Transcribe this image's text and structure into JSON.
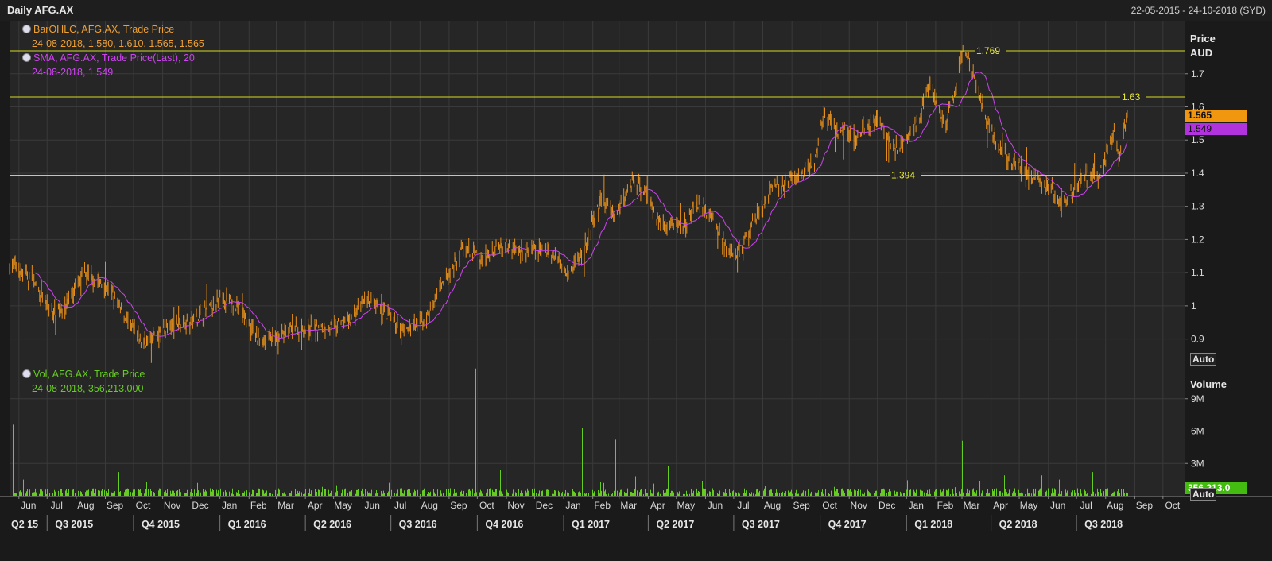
{
  "header": {
    "title": "Daily AFG.AX",
    "date_range": "22-05-2015 - 24-10-2018 (SYD)"
  },
  "legend": {
    "ohlc_label": "BarOHLC, AFG.AX, Trade Price",
    "ohlc_values": "24-08-2018, 1.580, 1.610, 1.565, 1.565",
    "sma_label": "SMA, AFG.AX, Trade Price(Last),  20",
    "sma_values": "24-08-2018, 1.549",
    "vol_label": "Vol, AFG.AX, Trade Price",
    "vol_values": "24-08-2018, 356,213.000"
  },
  "price_axis": {
    "title": "Price",
    "unit": "AUD",
    "auto_label": "Auto"
  },
  "volume_axis": {
    "title": "Volume",
    "auto_label": "Auto"
  },
  "tags": {
    "last_price": "1.565",
    "last_sma": "1.549",
    "last_volume": "356,213.0"
  },
  "colors": {
    "bars": "#e8901a",
    "sma": "#cc44ee",
    "volume": "#66cc22",
    "hlines": "#d8d820",
    "grid": "#3a3a3a",
    "price_tag": "#f0960f",
    "sma_tag": "#b033dd"
  },
  "chart_data": {
    "type": "ohlc",
    "x_range": [
      "2015-05-22",
      "2018-10-24"
    ],
    "price_ylim": [
      0.82,
      1.86
    ],
    "price_ticks": [
      "0.9",
      "1",
      "1.1",
      "1.2",
      "1.3",
      "1.4",
      "1.5",
      "1.6",
      "1.7"
    ],
    "volume_ylim": [
      0,
      12000000
    ],
    "volume_ticks": [
      "3M",
      "6M",
      "9M"
    ],
    "hlines": [
      {
        "value": 1.769,
        "label": "1.769"
      },
      {
        "value": 1.63,
        "label": "1.63"
      },
      {
        "value": 1.394,
        "label": "1.394"
      }
    ],
    "month_labels": [
      "Jun",
      "Jul",
      "Aug",
      "Sep",
      "Oct",
      "Nov",
      "Dec",
      "Jan",
      "Feb",
      "Mar",
      "Apr",
      "May",
      "Jun",
      "Jul",
      "Aug",
      "Sep",
      "Oct",
      "Nov",
      "Dec",
      "Jan",
      "Feb",
      "Mar",
      "Apr",
      "May",
      "Jun",
      "Jul",
      "Aug",
      "Sep",
      "Oct",
      "Nov",
      "Dec",
      "Jan",
      "Feb",
      "Mar",
      "Apr",
      "May",
      "Jun",
      "Jul",
      "Aug",
      "Sep",
      "Oct"
    ],
    "quarter_labels": [
      "Q2 15",
      "Q3 2015",
      "Q4 2015",
      "Q1 2016",
      "Q2 2016",
      "Q3 2016",
      "Q4 2016",
      "Q1 2017",
      "Q2 2017",
      "Q3 2017",
      "Q4 2017",
      "Q1 2018",
      "Q2 2018",
      "Q3 2018"
    ],
    "price_anchors": [
      [
        "2015-05-22",
        1.13
      ],
      [
        "2015-06-15",
        1.08
      ],
      [
        "2015-07-05",
        0.98
      ],
      [
        "2015-07-20",
        1.0
      ],
      [
        "2015-08-10",
        1.1
      ],
      [
        "2015-09-05",
        1.05
      ],
      [
        "2015-09-25",
        0.95
      ],
      [
        "2015-10-10",
        0.89
      ],
      [
        "2015-11-05",
        0.93
      ],
      [
        "2015-12-10",
        0.97
      ],
      [
        "2016-01-05",
        1.02
      ],
      [
        "2016-01-20",
        1.0
      ],
      [
        "2016-02-10",
        0.9
      ],
      [
        "2016-02-28",
        0.9
      ],
      [
        "2016-03-20",
        0.93
      ],
      [
        "2016-04-20",
        0.93
      ],
      [
        "2016-05-15",
        0.95
      ],
      [
        "2016-06-05",
        1.02
      ],
      [
        "2016-06-20",
        0.98
      ],
      [
        "2016-07-15",
        0.93
      ],
      [
        "2016-08-05",
        0.95
      ],
      [
        "2016-08-25",
        1.06
      ],
      [
        "2016-09-15",
        1.17
      ],
      [
        "2016-10-10",
        1.14
      ],
      [
        "2016-10-25",
        1.19
      ],
      [
        "2016-11-20",
        1.16
      ],
      [
        "2016-12-15",
        1.17
      ],
      [
        "2017-01-05",
        1.11
      ],
      [
        "2017-01-20",
        1.15
      ],
      [
        "2017-02-10",
        1.32
      ],
      [
        "2017-02-25",
        1.27
      ],
      [
        "2017-03-15",
        1.38
      ],
      [
        "2017-03-28",
        1.35
      ],
      [
        "2017-04-15",
        1.24
      ],
      [
        "2017-05-10",
        1.25
      ],
      [
        "2017-05-25",
        1.31
      ],
      [
        "2017-06-10",
        1.26
      ],
      [
        "2017-06-25",
        1.15
      ],
      [
        "2017-07-10",
        1.17
      ],
      [
        "2017-07-25",
        1.27
      ],
      [
        "2017-08-15",
        1.36
      ],
      [
        "2017-09-05",
        1.38
      ],
      [
        "2017-09-25",
        1.43
      ],
      [
        "2017-10-05",
        1.58
      ],
      [
        "2017-10-20",
        1.53
      ],
      [
        "2017-11-10",
        1.52
      ],
      [
        "2017-12-01",
        1.56
      ],
      [
        "2017-12-20",
        1.47
      ],
      [
        "2018-01-02",
        1.52
      ],
      [
        "2018-01-15",
        1.56
      ],
      [
        "2018-01-25",
        1.68
      ],
      [
        "2018-02-10",
        1.54
      ],
      [
        "2018-02-20",
        1.62
      ],
      [
        "2018-03-03",
        1.78
      ],
      [
        "2018-03-15",
        1.68
      ],
      [
        "2018-03-28",
        1.55
      ],
      [
        "2018-04-10",
        1.47
      ],
      [
        "2018-04-25",
        1.43
      ],
      [
        "2018-05-15",
        1.39
      ],
      [
        "2018-06-05",
        1.35
      ],
      [
        "2018-06-15",
        1.3
      ],
      [
        "2018-07-05",
        1.38
      ],
      [
        "2018-07-25",
        1.4
      ],
      [
        "2018-08-10",
        1.52
      ],
      [
        "2018-08-15",
        1.46
      ],
      [
        "2018-08-24",
        1.57
      ]
    ],
    "volume_baseline": 320000,
    "volume_spikes": [
      [
        "2015-05-25",
        6600000
      ],
      [
        "2015-06-05",
        1500000
      ],
      [
        "2015-06-20",
        2100000
      ],
      [
        "2015-09-15",
        2200000
      ],
      [
        "2015-10-15",
        1300000
      ],
      [
        "2015-12-08",
        1200000
      ],
      [
        "2016-09-29",
        11800000
      ],
      [
        "2016-10-25",
        2400000
      ],
      [
        "2017-01-20",
        6300000
      ],
      [
        "2017-02-12",
        1200000
      ],
      [
        "2017-02-25",
        5200000
      ],
      [
        "2017-03-18",
        1800000
      ],
      [
        "2017-04-22",
        2800000
      ],
      [
        "2017-05-28",
        1400000
      ],
      [
        "2017-07-15",
        1000000
      ],
      [
        "2017-12-10",
        1800000
      ],
      [
        "2018-03-01",
        5100000
      ],
      [
        "2018-03-20",
        1400000
      ],
      [
        "2018-04-15",
        1900000
      ],
      [
        "2018-05-25",
        1900000
      ],
      [
        "2018-06-12",
        1500000
      ],
      [
        "2018-07-18",
        2200000
      ]
    ]
  }
}
